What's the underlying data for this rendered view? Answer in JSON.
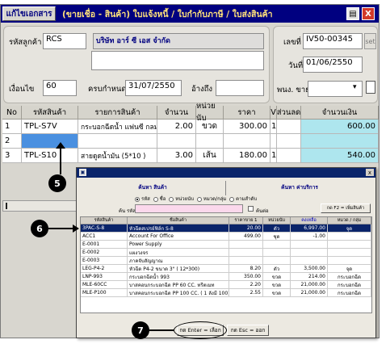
{
  "titlebar": {
    "edit_button": "แก้ไขเอกสาร",
    "title": "(ขายเชื่อ - สินค้า)  ใบแจ้งหนี้ / ใบกำกับภาษี / ใบส่งสินค้า",
    "print_icon": "print-icon",
    "close_icon": "close-icon",
    "close_label": "X",
    "print_label": "▤"
  },
  "header": {
    "customer_code_label": "รหัสลูกค้า",
    "customer_code": "RCS",
    "customer_name": "บริษัท อาร์ ซี เอส จำกัด",
    "doc_no_label": "เลขที่",
    "doc_no": "IV50-00345",
    "set_button": "set",
    "date_label": "วันที่",
    "date": "01/06/2550",
    "credit_label": "เงื่อนไข",
    "credit_days": "60",
    "due_label": "ครบกำหนด",
    "due_date": "31/07/2550",
    "ref_label": "อ้างถึง",
    "ref_value": "",
    "sales_label": "พนง. ขาย",
    "sales_value": "",
    "dropdown_arrow": "▾",
    "doc_icon": "document-icon"
  },
  "grid": {
    "columns": [
      "No",
      "รหัสสินค้า",
      "รายการสินค้า",
      "จำนวน",
      "หน่วยนับ",
      "ราคา",
      "V",
      "ส่วนลด",
      "จำนวนเงิน"
    ],
    "rows": [
      {
        "no": "1",
        "code": "TPL-S7V",
        "name": "กระบอกฉีดน้ำ แฟนซี กลม ม่วง",
        "qty": "2.00",
        "unit": "ขวด",
        "price": "300.00",
        "v": "1",
        "disc": "",
        "amount": "600.00"
      },
      {
        "no": "2",
        "code": "",
        "name": "",
        "qty": "",
        "unit": "",
        "price": "",
        "v": "",
        "disc": "",
        "amount": ""
      },
      {
        "no": "3",
        "code": "TPL-S10",
        "name": "สายดูดน้ำมัน          (5*10 )",
        "qty": "3.00",
        "unit": "เส้น",
        "price": "180.00",
        "v": "1",
        "disc": "",
        "amount": "540.00"
      }
    ]
  },
  "dialog": {
    "tab_product": "ค้นหา  สินค้า",
    "tab_service": "ค้นหา  ค่าบริการ",
    "radios": [
      "รหัส",
      "ชื่อ",
      "หน่วยนับ",
      "หมวด/กลุ่ม",
      "ตามสำดับ"
    ],
    "search_label": "ค้น รหัส",
    "search_value": "",
    "checkbox_label": "ค้นต่อ",
    "f2_button": "กด F2 = เพิ่มสินค้า",
    "columns": [
      "รหัสสินค้า",
      "ชื่อสินค้า",
      "ราคาขาย 1",
      "หน่วยนับ",
      "คงเหลือ",
      "หมวด / กลุ่ม"
    ],
    "rows": [
      {
        "code": "3PAC-S-8",
        "name": "หัวฉีดสเปรย์ฟิล์ก S-8",
        "price": "20.00",
        "unit": "ตัว",
        "stock": "6,997.00",
        "group": "จุด"
      },
      {
        "code": "ACC1",
        "name": "Account For Office",
        "price": "499.00",
        "unit": "ชุด",
        "stock": "-1.00",
        "group": ""
      },
      {
        "code": "E-0001",
        "name": "Power Supply",
        "price": "",
        "unit": "",
        "stock": "",
        "group": ""
      },
      {
        "code": "E-0002",
        "name": "แผงวงจร",
        "price": "",
        "unit": "",
        "stock": "",
        "group": ""
      },
      {
        "code": "E-0003",
        "name": "ภาคจับสัญญาณ",
        "price": "",
        "unit": "",
        "stock": "",
        "group": ""
      },
      {
        "code": "LEG-P4-2",
        "name": "หัวฉีด P4-2 ขนาด 3\" ( 12*300)",
        "price": "8.20",
        "unit": "ตัว",
        "stock": "3,500.00",
        "group": "จุด"
      },
      {
        "code": "LNP-993",
        "name": "กระบอกฉีดน้ำ 993",
        "price": "350.00",
        "unit": "ขวด",
        "stock": "214.00",
        "group": "กระบอกฉีด"
      },
      {
        "code": "MLE-60CC",
        "name": "บาสคอนกระบอกฉีด PP 60 CC. ทรีตเมท",
        "price": "2.20",
        "unit": "ขวด",
        "stock": "21,000.00",
        "group": "กระบอกฉีด"
      },
      {
        "code": "MLE-P100",
        "name": "บาสคอนกระบอกฉีด PP 100 CC. ( 1 ลังมี 100)",
        "price": "2.55",
        "unit": "ขวด",
        "stock": "21,000.00",
        "group": "กระบอกฉีด"
      }
    ],
    "enter_button": "กด Enter = เลือก",
    "esc_button": "กด Esc = ออก",
    "title_icon": "app-icon",
    "close_label": "x",
    "title_icon_label": "▣"
  },
  "callouts": [
    "5",
    "6",
    "7"
  ]
}
